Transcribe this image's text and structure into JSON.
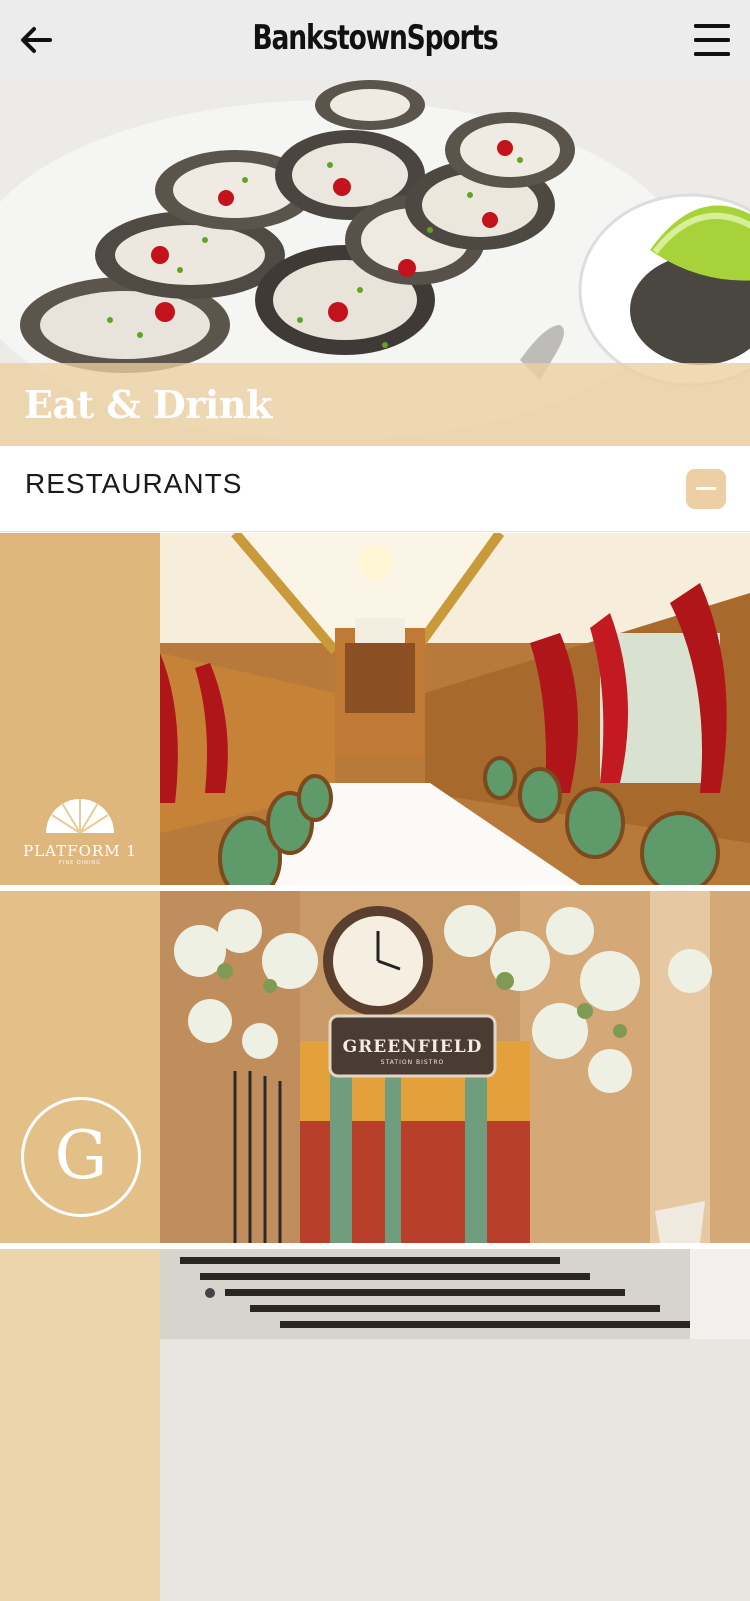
{
  "header": {
    "brand": "BankstownSports",
    "back_icon": "arrow-left-icon",
    "menu_icon": "hamburger-menu-icon"
  },
  "hero": {
    "title": "Eat & Drink"
  },
  "section": {
    "label": "RESTAURANTS",
    "toggle_icon": "minus-icon"
  },
  "restaurants": [
    {
      "logo_text": "PLATFORM 1",
      "logo_subtext": "FINE DINING"
    },
    {
      "sign_text": "GREENFIELD",
      "sign_subtext": "STATION BISTRO",
      "logo_letter": "G"
    },
    {}
  ],
  "colors": {
    "accent_tan": "#eccfa5",
    "header_bg": "#ececec"
  }
}
